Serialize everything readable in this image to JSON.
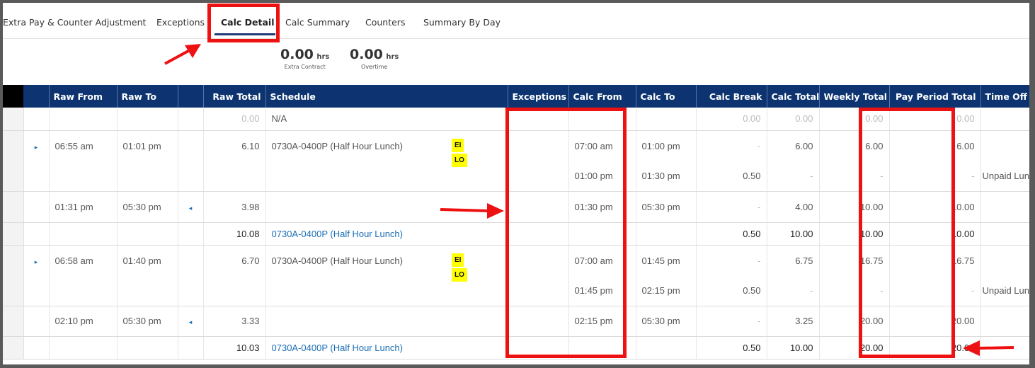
{
  "tabs": [
    {
      "label": "Extra Pay & Counter Adjustment"
    },
    {
      "label": "Exceptions"
    },
    {
      "label": "Calc Detail"
    },
    {
      "label": "Calc Summary"
    },
    {
      "label": "Counters"
    },
    {
      "label": "Summary By Day"
    }
  ],
  "summary": {
    "extra_contract": {
      "value": "0.00",
      "unit": "hrs",
      "label": "Extra Contract"
    },
    "overtime": {
      "value": "0.00",
      "unit": "hrs",
      "label": "Overtime"
    }
  },
  "columns": [
    "Raw From",
    "Raw To",
    "Raw Total",
    "Schedule",
    "Exceptions",
    "Calc From",
    "Calc To",
    "Calc Break",
    "Calc Total",
    "Weekly Total",
    "Pay Period Total",
    "Time Off"
  ],
  "rows": [
    {
      "raw_total": "0.00",
      "schedule": "N/A",
      "calc_break": "0.00",
      "calc_total": "0.00",
      "weekly_total": "0.00",
      "pay_period_total": "0.00"
    },
    {
      "raw_from": "06:55 am",
      "raw_to": "01:01 pm",
      "raw_total": "6.10",
      "schedule": "0730A-0400P (Half Hour Lunch)",
      "calc_from": "07:00 am",
      "calc_to": "01:00 pm",
      "calc_break": "-",
      "calc_total": "6.00",
      "weekly_total": "6.00",
      "pay_period_total": "6.00"
    },
    {
      "calc_from": "01:00 pm",
      "calc_to": "01:30 pm",
      "calc_break": "0.50",
      "calc_total": "-",
      "weekly_total": "-",
      "pay_period_total": "-",
      "time_off": "Unpaid Lunch"
    },
    {
      "raw_from": "01:31 pm",
      "raw_to": "05:30 pm",
      "raw_total": "3.98",
      "calc_from": "01:30 pm",
      "calc_to": "05:30 pm",
      "calc_break": "-",
      "calc_total": "4.00",
      "weekly_total": "10.00",
      "pay_period_total": "10.00"
    },
    {
      "raw_total": "10.08",
      "schedule": "0730A-0400P (Half Hour Lunch)",
      "calc_break": "0.50",
      "calc_total": "10.00",
      "weekly_total": "10.00",
      "pay_period_total": "10.00"
    },
    {
      "raw_from": "06:58 am",
      "raw_to": "01:40 pm",
      "raw_total": "6.70",
      "schedule": "0730A-0400P (Half Hour Lunch)",
      "calc_from": "07:00 am",
      "calc_to": "01:45 pm",
      "calc_break": "-",
      "calc_total": "6.75",
      "weekly_total": "16.75",
      "pay_period_total": "16.75"
    },
    {
      "calc_from": "01:45 pm",
      "calc_to": "02:15 pm",
      "calc_break": "0.50",
      "calc_total": "-",
      "weekly_total": "-",
      "pay_period_total": "-",
      "time_off": "Unpaid Lunch"
    },
    {
      "raw_from": "02:10 pm",
      "raw_to": "05:30 pm",
      "raw_total": "3.33",
      "calc_from": "02:15 pm",
      "calc_to": "05:30 pm",
      "calc_break": "-",
      "calc_total": "3.25",
      "weekly_total": "20.00",
      "pay_period_total": "20.00"
    },
    {
      "raw_total": "10.03",
      "schedule": "0730A-0400P (Half Hour Lunch)",
      "calc_break": "0.50",
      "calc_total": "10.00",
      "weekly_total": "20.00",
      "pay_period_total": "20.00"
    }
  ],
  "exception_badges": [
    {
      "codes": [
        "EI",
        "LO"
      ]
    },
    {
      "codes": [
        "EI",
        "LO"
      ]
    }
  ],
  "icons": {
    "expand": "caret-right-icon",
    "collapse": "caret-left-icon",
    "annotation": "red-arrow-icon"
  },
  "colors": {
    "header_bg": "#0d3470",
    "link": "#1c6fb6",
    "highlight": "#ffff00",
    "annotation": "#ee1111"
  }
}
